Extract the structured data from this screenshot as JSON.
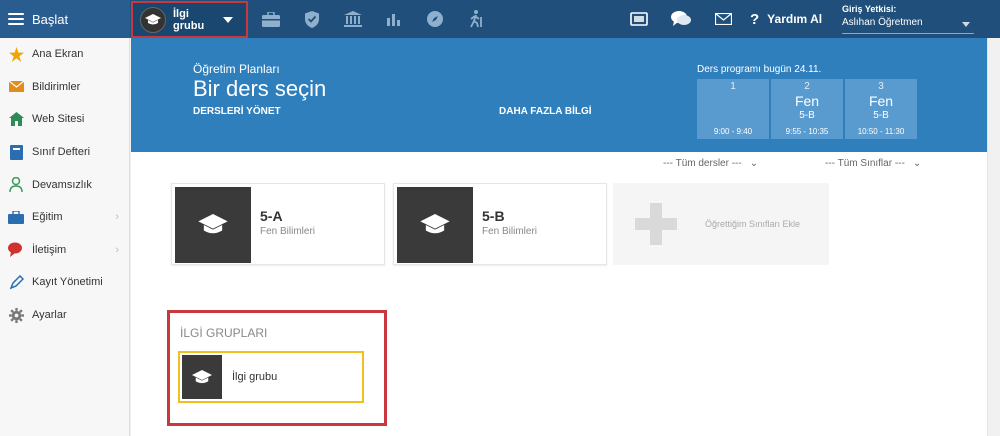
{
  "topbar": {
    "brand_label": "Başlat",
    "group_switch": {
      "label": "İlgi grubu"
    },
    "nav_icons": [
      "briefcase-icon",
      "shield-icon",
      "institution-icon",
      "bar-chart-icon",
      "compass-icon",
      "hiking-icon"
    ],
    "tools": [
      "cast-icon",
      "chat-icon",
      "mail-icon"
    ],
    "help_label": "Yardım Al",
    "auth": {
      "title": "Giriş Yetkisi:",
      "user": "Aslıhan Öğretmen"
    }
  },
  "sidebar": {
    "items": [
      {
        "label": "Ana Ekran",
        "icon": "star-icon",
        "color": "#f0a500",
        "chevron": false
      },
      {
        "label": "Bildirimler",
        "icon": "envelope-icon",
        "color": "#e28c1e",
        "chevron": false
      },
      {
        "label": "Web Sitesi",
        "icon": "home-icon",
        "color": "#2e8b57",
        "chevron": false
      },
      {
        "label": "Sınıf Defteri",
        "icon": "book-icon",
        "color": "#2a6db0",
        "chevron": false
      },
      {
        "label": "Devamsızlık",
        "icon": "person-icon",
        "color": "#3a9a5a",
        "chevron": false
      },
      {
        "label": "Eğitim",
        "icon": "education-icon",
        "color": "#2a6db0",
        "chevron": true
      },
      {
        "label": "İletişim",
        "icon": "speech-icon",
        "color": "#d0322f",
        "chevron": true
      },
      {
        "label": "Kayıt Yönetimi",
        "icon": "pen-icon",
        "color": "#2a6db0",
        "chevron": false
      },
      {
        "label": "Ayarlar",
        "icon": "gear-icon",
        "color": "#777777",
        "chevron": false
      }
    ]
  },
  "banner": {
    "subtitle": "Öğretim Planları",
    "title": "Bir ders seçin",
    "link_manage": "DERSLERİ YÖNET",
    "link_more": "DAHA FAZLA BİLGİ",
    "schedule_caption": "Ders programı bugün 24.11.",
    "slots": [
      {
        "num": "1",
        "subject": "",
        "class": "",
        "time": "9:00 - 9:40"
      },
      {
        "num": "2",
        "subject": "Fen",
        "class": "5-B",
        "time": "9:55 - 10:35"
      },
      {
        "num": "3",
        "subject": "Fen",
        "class": "5-B",
        "time": "10:50 - 11:30"
      }
    ]
  },
  "filters": {
    "lessons": "--- Tüm dersler ---",
    "classes": "--- Tüm Sınıflar ---"
  },
  "courses": [
    {
      "name": "5-A",
      "subject": "Fen Bilimleri"
    },
    {
      "name": "5-B",
      "subject": "Fen Bilimleri"
    }
  ],
  "add_class_label": "Öğrettiğim Sınıfları Ekle",
  "interest_groups": {
    "title": "İLGİ GRUPLARI",
    "items": [
      {
        "name": "İlgi grubu"
      }
    ]
  },
  "colors": {
    "topbar": "#1f4f7a",
    "banner": "#2f7fbd",
    "highlight": "#c9373f",
    "group_border": "#f0c020"
  }
}
